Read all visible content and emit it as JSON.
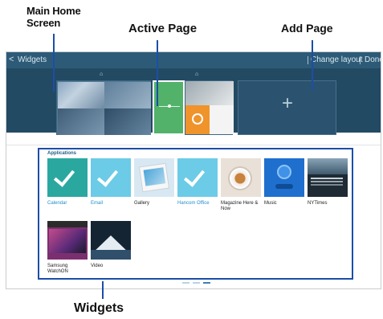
{
  "callouts": {
    "main_home_screen_line1": "Main Home",
    "main_home_screen_line2": "Screen",
    "active_page": "Active Page",
    "add_page": "Add Page",
    "widgets": "Widgets"
  },
  "titlebar": {
    "back_glyph": "<",
    "title": "Widgets",
    "change_layout": "Change layout",
    "done": "Done"
  },
  "add_page_glyph": "+",
  "home_marker_glyph": "⌂",
  "panel": {
    "heading": "Applications",
    "widgets": [
      {
        "label": "Calendar",
        "icon": "calendar-widget-icon"
      },
      {
        "label": "Email",
        "icon": "email-widget-icon"
      },
      {
        "label": "Gallery",
        "icon": "gallery-widget-icon"
      },
      {
        "label": "Hancom Office",
        "icon": "hancom-office-widget-icon"
      },
      {
        "label": "Magazine Here & Now",
        "icon": "magazine-widget-icon"
      },
      {
        "label": "Music",
        "icon": "music-widget-icon"
      },
      {
        "label": "NYTimes",
        "icon": "nytimes-widget-icon"
      },
      {
        "label": "Samsung WatchON",
        "icon": "watchon-widget-icon"
      },
      {
        "label": "Video",
        "icon": "video-widget-icon"
      }
    ]
  },
  "colors": {
    "callout_line": "#1c4ea8",
    "title_bar": "#2d5b77",
    "page_strip": "#234a63",
    "active_page": "#52b26a",
    "widget_label_blue": "#1f8fcf"
  }
}
